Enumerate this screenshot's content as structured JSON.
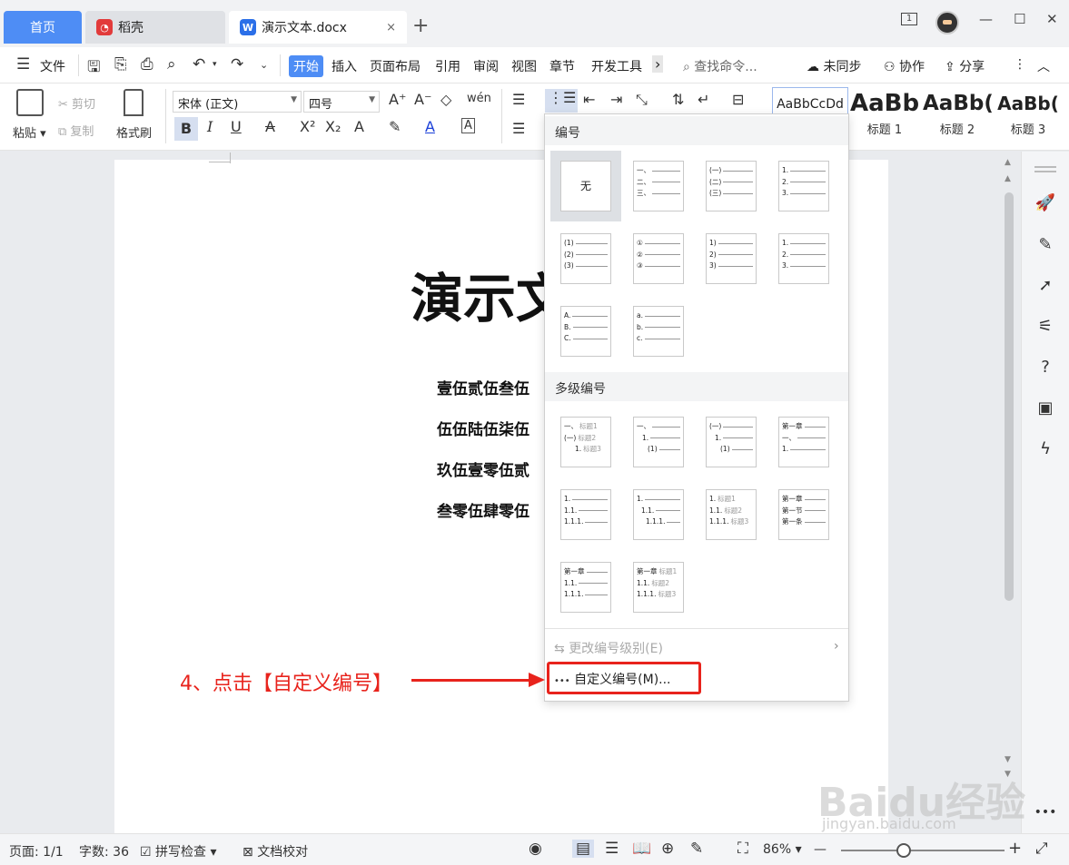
{
  "tabs": {
    "home": "首页",
    "daoke": "稻壳",
    "doc": "演示文本.docx",
    "close": "×",
    "add": "+"
  },
  "window": {
    "page_indicator": "1",
    "minimize": "—",
    "maximize": "☐",
    "close": "✕"
  },
  "menu": {
    "file": "文件",
    "items": [
      "开始",
      "插入",
      "页面布局",
      "引用",
      "审阅",
      "视图",
      "章节",
      "开发工具"
    ],
    "more": "›",
    "search_placeholder": "查找命令...",
    "unsync": "未同步",
    "collab": "协作",
    "share": "分享",
    "kebab": "⋮",
    "collapse": "︿"
  },
  "ribbon": {
    "paste": "粘贴",
    "cut": "剪切",
    "copy": "复制",
    "format_painter": "格式刷",
    "font_name": "宋体 (正文)",
    "font_size": "四号",
    "bold": "B",
    "italic": "I",
    "underline": "U",
    "strike": "A",
    "superscript": "X²",
    "subscript": "X₂",
    "text_effect": "A",
    "highlight": "✎",
    "font_color": "A",
    "char_border": "A",
    "grow": "A⁺",
    "shrink": "A⁻",
    "clear": "◇",
    "pinyin": "wén",
    "styles": [
      {
        "sample": "AaBbCcDd",
        "name": ""
      },
      {
        "sample": "AaBb",
        "name": "标题 1"
      },
      {
        "sample": "AaBb(",
        "name": "标题 2"
      },
      {
        "sample": "AaBb(",
        "name": "标题 3"
      }
    ]
  },
  "document": {
    "title": "演示文本",
    "lines": [
      "壹伍贰伍叁伍",
      "伍伍陆伍柒伍",
      "玖伍壹零伍贰",
      "叁零伍肆零伍"
    ]
  },
  "dropdown": {
    "section_numbering": "编号",
    "none_label": "无",
    "single": [
      {
        "lines": [
          "一、",
          "二、",
          "三、"
        ]
      },
      {
        "lines": [
          "(一)",
          "(二)",
          "(三)"
        ]
      },
      {
        "lines": [
          "1.",
          "2.",
          "3."
        ]
      },
      {
        "lines": [
          "(1)",
          "(2)",
          "(3)"
        ]
      },
      {
        "lines": [
          "①",
          "②",
          "③"
        ]
      },
      {
        "lines": [
          "1)",
          "2)",
          "3)"
        ]
      },
      {
        "lines": [
          "1.",
          "2.",
          "3."
        ]
      },
      {
        "lines": [
          "A.",
          "B.",
          "C."
        ]
      },
      {
        "lines": [
          "a.",
          "b.",
          "c."
        ]
      }
    ],
    "section_multilevel": "多级编号",
    "multi": [
      {
        "lines": [
          [
            "一、",
            "标题1"
          ],
          [
            "(一)",
            "标题2"
          ],
          [
            "1.",
            "标题3"
          ]
        ]
      },
      {
        "lines": [
          [
            "一、",
            ""
          ],
          [
            "1.",
            ""
          ],
          [
            "(1)",
            ""
          ]
        ]
      },
      {
        "lines": [
          [
            "(一)",
            ""
          ],
          [
            "1.",
            ""
          ],
          [
            "(1)",
            ""
          ]
        ]
      },
      {
        "lines": [
          [
            "第一章",
            ""
          ],
          [
            "一、",
            ""
          ],
          [
            "1.",
            ""
          ]
        ]
      },
      {
        "lines": [
          [
            "1.",
            ""
          ],
          [
            "1.1.",
            ""
          ],
          [
            "1.1.1.",
            ""
          ]
        ]
      },
      {
        "lines": [
          [
            "1.",
            ""
          ],
          [
            "1.1.",
            ""
          ],
          [
            "1.1.1.",
            ""
          ]
        ]
      },
      {
        "lines": [
          [
            "1.",
            "标题1"
          ],
          [
            "1.1.",
            "标题2"
          ],
          [
            "1.1.1.",
            "标题3"
          ]
        ]
      },
      {
        "lines": [
          [
            "第一章",
            ""
          ],
          [
            "第一节",
            ""
          ],
          [
            "第一条",
            ""
          ]
        ]
      },
      {
        "lines": [
          [
            "第一章",
            ""
          ],
          [
            "1.1.",
            ""
          ],
          [
            "1.1.1.",
            ""
          ]
        ]
      },
      {
        "lines": [
          [
            "第一章",
            "标题1"
          ],
          [
            "1.1.",
            "标题2"
          ],
          [
            "1.1.1.",
            "标题3"
          ]
        ]
      }
    ],
    "change_level": "更改编号级别(E)",
    "custom": "自定义编号(M)...",
    "submenu_arrow": "›",
    "dots": "•••"
  },
  "annotation": "4、点击【自定义编号】",
  "status": {
    "page": "页面: 1/1",
    "words": "字数: 36",
    "spell": "拼写检查",
    "proof": "文档校对",
    "zoom": "86%",
    "zoom_minus": "—",
    "zoom_plus": "+"
  },
  "watermark": {
    "main": "Baidu经验",
    "sub": "jingyan.baidu.com"
  },
  "colors": {
    "accent": "#4e8df5",
    "annotation": "#e8231c"
  }
}
